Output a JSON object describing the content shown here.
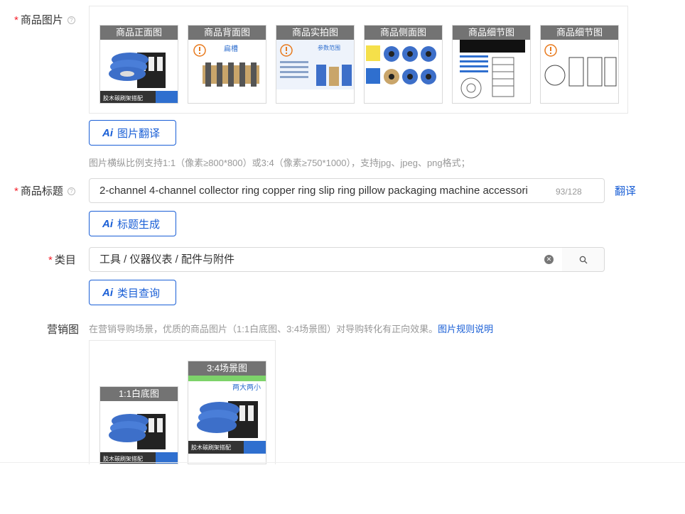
{
  "product_images": {
    "label": "商品图片",
    "required_mark": "*",
    "help": "?",
    "thumbs": [
      {
        "caption": "商品正面图",
        "badge": ""
      },
      {
        "caption": "商品背面图",
        "badge": "扁槽"
      },
      {
        "caption": "商品实拍图",
        "badge": "参数范围"
      },
      {
        "caption": "商品侧面图",
        "badge": ""
      },
      {
        "caption": "商品细节图",
        "badge": ""
      },
      {
        "caption": "商品细节图",
        "badge": ""
      }
    ],
    "translate_button": "图片翻译",
    "hint": "图片横纵比例支持1:1（像素≥800*800）或3:4（像素≥750*1000），支持jpg、jpeg、png格式；"
  },
  "product_title": {
    "label": "商品标题",
    "required_mark": "*",
    "help": "?",
    "value": "2-channel 4-channel collector ring copper ring slip ring pillow packaging machine accessori",
    "counter": "93/128",
    "translate_link": "翻译",
    "generate_button": "标题生成"
  },
  "category": {
    "label": "类目",
    "required_mark": "*",
    "value": "工具 / 仪器仪表 / 配件与附件",
    "query_button": "类目查询"
  },
  "marketing": {
    "label": "营销图",
    "hint": "在营销导购场景，优质的商品图片（1:1白底图、3:4场景图）对导购转化有正向效果。",
    "rules_link": "图片规则说明",
    "thumbs": [
      {
        "caption": "1:1白底图"
      },
      {
        "caption": "3:4场景图"
      }
    ]
  },
  "ai_glyph": "Ai",
  "colors": {
    "accent": "#1a5fd6",
    "required": "#f5222d"
  }
}
